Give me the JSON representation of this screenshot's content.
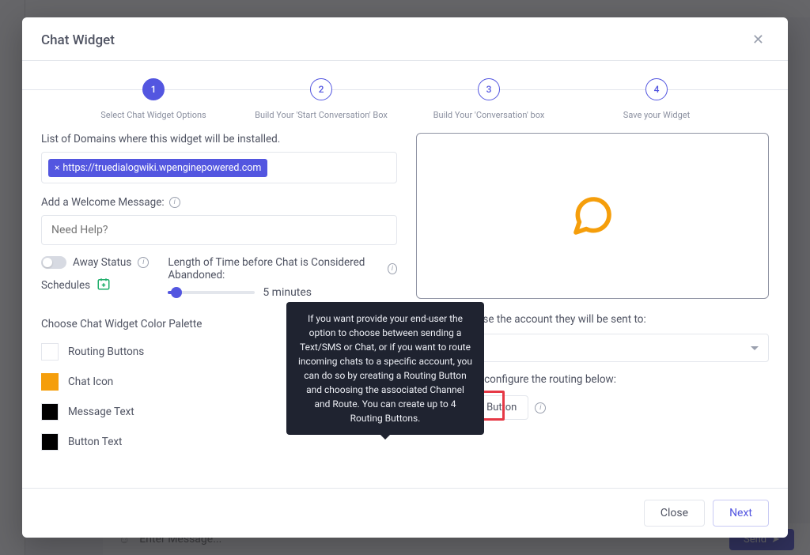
{
  "modal": {
    "title": "Chat Widget",
    "steps": [
      {
        "num": "1",
        "label": "Select Chat Widget Options"
      },
      {
        "num": "2",
        "label": "Build Your 'Start Conversation' Box"
      },
      {
        "num": "3",
        "label": "Build Your 'Conversation' box"
      },
      {
        "num": "4",
        "label": "Save your Widget"
      }
    ],
    "domains_label": "List of Domains where this widget will be installed.",
    "domain_tag": "https://truedialogwiki.wpenginepowered.com",
    "welcome_label": "Add a Welcome Message:",
    "welcome_placeholder": "Need Help?",
    "away_label": "Away Status",
    "schedules_label": "Schedules",
    "abandon_label": "Length of Time before Chat is Considered Abandoned:",
    "abandon_value": "5 minutes",
    "palette_label": "Choose Chat Widget Color Palette",
    "palette": {
      "routing": "Routing Buttons",
      "chat_icon": "Chat Icon",
      "message_text": "Message Text",
      "button_text": "Button Text"
    },
    "right": {
      "account_label_suffix": "account, choose the account they will be sent to:",
      "routing_label_suffix": "iple accounts, configure the routing below:",
      "add_routing": "Add Routing Button",
      "tooltip": "If you want provide your end-user the option to choose between sending a Text/SMS or Chat, or if you want to route incoming chats to a specific account, you can do so by creating a Routing Button and choosing the associated Channel and Route. You can create up to 4 Routing Buttons."
    },
    "close": "Close",
    "next": "Next"
  },
  "bg": {
    "enter_message": "Enter Message...",
    "send": "Send"
  },
  "colors": {
    "indigo": "#5356e0",
    "orange": "#f59e0b"
  }
}
